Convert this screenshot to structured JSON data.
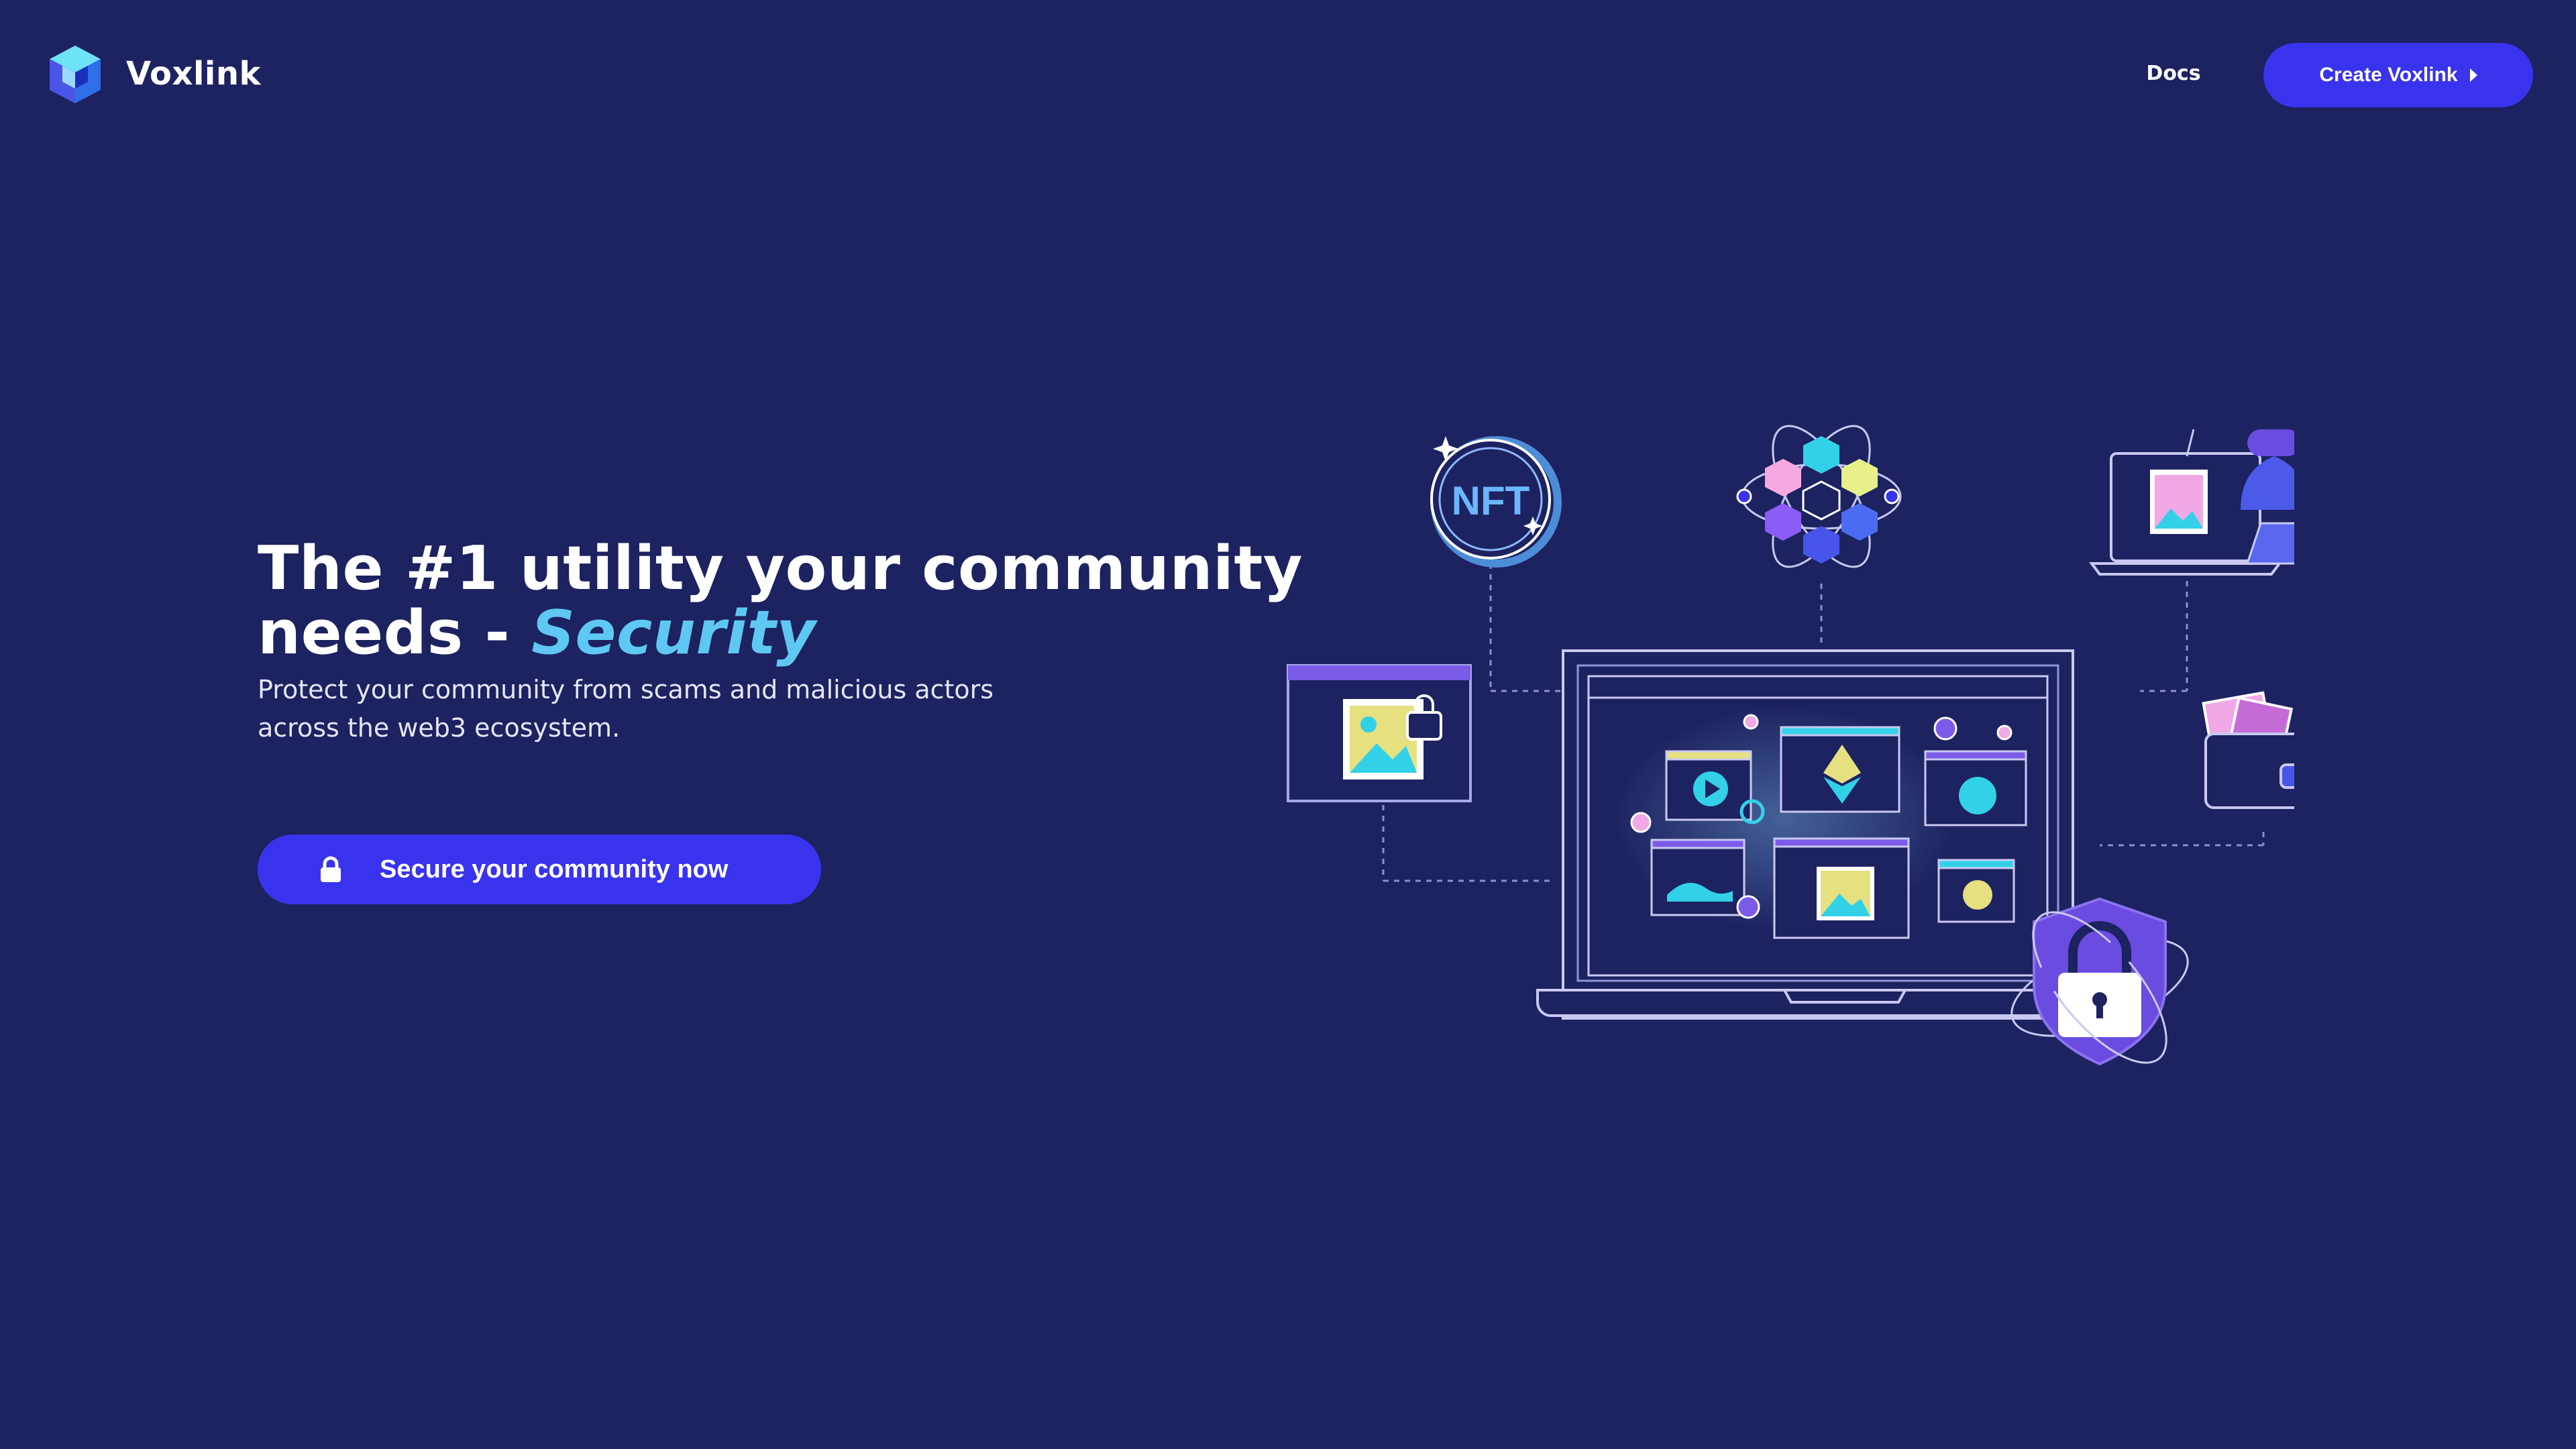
{
  "nav": {
    "brand": "Voxlink",
    "docs_label": "Docs",
    "create_label": "Create Voxlink"
  },
  "hero": {
    "title_main": "The #1 utility your community needs - ",
    "title_accent": "Security",
    "subtitle_line1": "Protect your community from scams and malicious actors",
    "subtitle_line2": "across the web3 ecosystem.",
    "cta_label": "Secure your community now"
  },
  "illustration": {
    "nft_badge": "NFT"
  },
  "colors": {
    "background": "#1d2260",
    "accent": "#3a33ee",
    "highlight": "#5ec8f2"
  },
  "icons": [
    "voxlink-logo-icon",
    "caret-right-icon",
    "lock-icon",
    "nft-badge-icon",
    "blockchain-atom-icon",
    "laptop-icon",
    "hacker-icon",
    "wallet-icon",
    "image-window-icon",
    "shield-lock-icon",
    "ethereum-icon"
  ]
}
